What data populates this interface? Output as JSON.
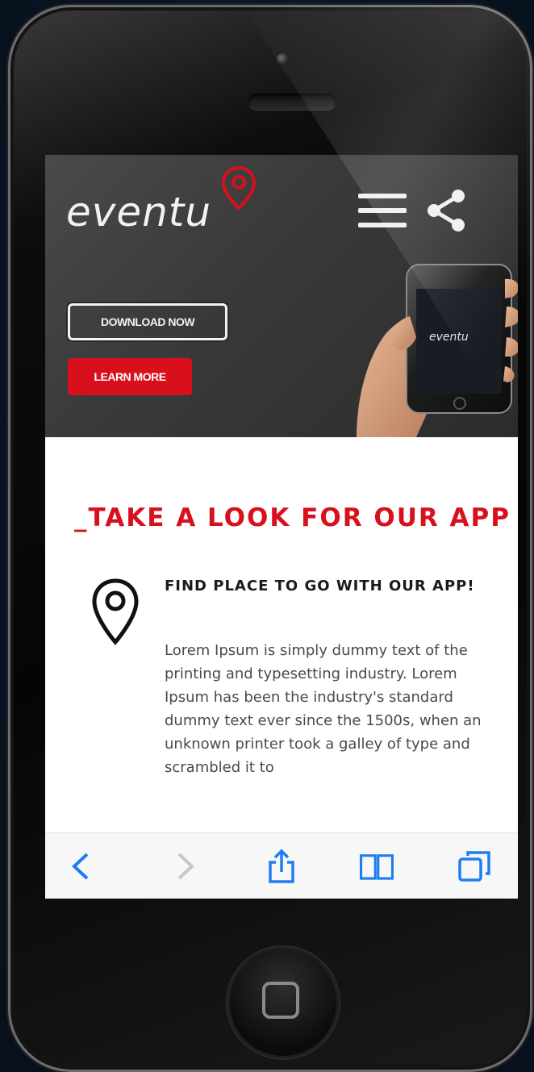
{
  "header": {
    "logo_text": "eventu"
  },
  "hero": {
    "download_label": "DOWNLOAD NOW",
    "learn_label": "LEARN MORE",
    "phone_logo_text": "eventu"
  },
  "section": {
    "title": "_TAKE A LOOK FOR OUR APP",
    "feature_heading": "FIND PLACE TO GO WITH OUR APP!",
    "feature_text": "Lorem Ipsum is simply dummy text of the printing and typesetting industry. Lorem Ipsum has been the industry's standard dummy text ever since the 1500s, when an unknown printer took a galley of type and scrambled it to"
  },
  "browser_toolbar": {
    "items": [
      "back-icon",
      "forward-icon",
      "share-icon",
      "bookmarks-icon",
      "tabs-icon"
    ]
  },
  "colors": {
    "accent": "#d8101c",
    "toolbar_icon": "#1d7ef2",
    "hero_bg": "#3a3a3a"
  }
}
